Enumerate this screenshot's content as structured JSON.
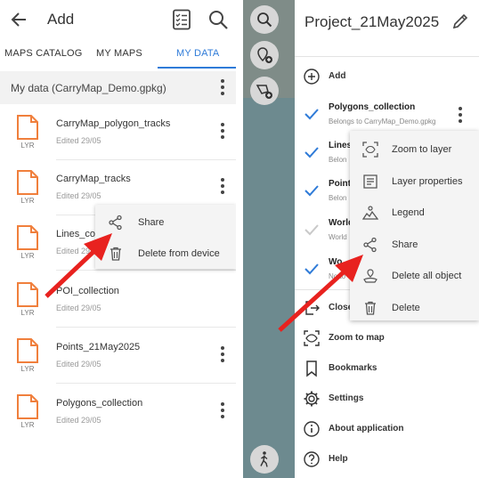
{
  "left": {
    "title": "Add",
    "tabs": [
      {
        "label": "MAPS CATALOG"
      },
      {
        "label": "MY MAPS"
      },
      {
        "label": "MY DATA"
      }
    ],
    "data_header": "My data (CarryMap_Demo.gpkg)",
    "file_badge": "LYR",
    "files": [
      {
        "name": "CarryMap_polygon_tracks",
        "edited": "Edited 29/05"
      },
      {
        "name": "CarryMap_tracks",
        "edited": "Edited 29/05"
      },
      {
        "name": "Lines_col",
        "edited": "Edited 29/05"
      },
      {
        "name": "POI_collection",
        "edited": "Edited 29/05"
      },
      {
        "name": "Points_21May2025",
        "edited": "Edited 29/05"
      },
      {
        "name": "Polygons_collection",
        "edited": "Edited 29/05"
      }
    ],
    "context_menu": [
      {
        "label": "Share",
        "icon": "share-icon"
      },
      {
        "label": "Delete from device",
        "icon": "trash-icon"
      }
    ]
  },
  "right": {
    "project_title": "Project_21May2025",
    "add_label": "Add",
    "layers": [
      {
        "name": "Polygons_collection",
        "sub": "Belongs to CarryMap_Demo.gpkg",
        "checked": true
      },
      {
        "name": "Lines",
        "sub": "Belon",
        "checked": true
      },
      {
        "name": "Point",
        "sub": "Belon",
        "checked": true
      },
      {
        "name": "World",
        "sub": "World",
        "checked": false
      },
      {
        "name": "Wo",
        "sub": "No to",
        "checked": true
      }
    ],
    "menu_rows": [
      {
        "label": "Close",
        "icon": "close-project-icon"
      },
      {
        "label": "Zoom to map",
        "icon": "zoom-map-icon"
      },
      {
        "label": "Bookmarks",
        "icon": "bookmark-icon"
      },
      {
        "label": "Settings",
        "icon": "gear-icon"
      },
      {
        "label": "About application",
        "icon": "info-icon"
      },
      {
        "label": "Help",
        "icon": "help-icon"
      }
    ],
    "context_menu": [
      {
        "label": "Zoom to layer",
        "icon": "zoom-layer-icon"
      },
      {
        "label": "Layer properties",
        "icon": "layer-properties-icon"
      },
      {
        "label": "Legend",
        "icon": "legend-icon"
      },
      {
        "label": "Share",
        "icon": "share-icon"
      },
      {
        "label": "Delete all object",
        "icon": "delete-objects-icon"
      },
      {
        "label": "Delete",
        "icon": "trash-icon"
      }
    ]
  },
  "colors": {
    "accent": "#2f7bd8",
    "file_icon": "#f07f3c",
    "arrow": "#e8221f",
    "map_water": "#6d8a8f"
  }
}
